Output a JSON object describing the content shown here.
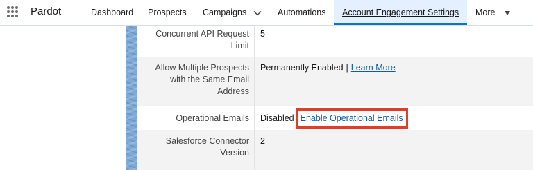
{
  "nav": {
    "app_name": "Pardot",
    "items": [
      {
        "label": "Dashboard"
      },
      {
        "label": "Prospects"
      },
      {
        "label": "Campaigns"
      },
      {
        "label": "Automations"
      },
      {
        "label": "Account Engagement Settings"
      },
      {
        "label": "More"
      }
    ],
    "active_index": 4,
    "accent_color": "#0176d3"
  },
  "settings": {
    "rows": [
      {
        "label": "Concurrent API Request Limit",
        "value": "5"
      },
      {
        "label": "Allow Multiple Prospects with the Same Email Address",
        "value": "Permanently Enabled",
        "separator": "|",
        "link": "Learn More"
      },
      {
        "label": "Operational Emails",
        "value": "Disabled",
        "link": "Enable Operational Emails"
      },
      {
        "label": "Salesforce Connector Version",
        "value": "2"
      }
    ]
  },
  "highlight_color": "#e23d28"
}
